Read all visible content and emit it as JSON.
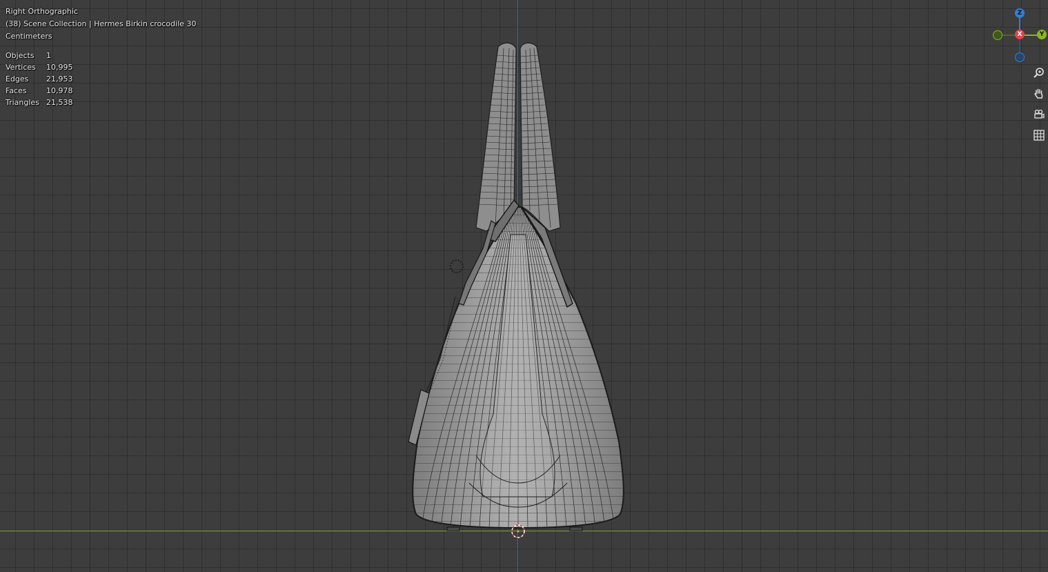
{
  "viewport": {
    "view_name": "Right Orthographic",
    "collection_line": "(38) Scene Collection | Hermes Birkin crocodile 30",
    "units": "Centimeters"
  },
  "stats": [
    {
      "label": "Objects",
      "value": "1"
    },
    {
      "label": "Vertices",
      "value": "10,995"
    },
    {
      "label": "Edges",
      "value": "21,953"
    },
    {
      "label": "Faces",
      "value": "10,978"
    },
    {
      "label": "Triangles",
      "value": "21,538"
    }
  ],
  "gizmo": {
    "z_label": "Z",
    "x_label": "X",
    "y_label": "Y",
    "colors": {
      "z": "#2f7fd6",
      "x": "#e8404f",
      "y": "#84b820",
      "neg_y": "#4e6b1f",
      "neg_z": "#28527f"
    }
  },
  "tools": [
    "zoom-icon",
    "pan-hand-icon",
    "camera-icon",
    "grid-icon"
  ],
  "colors": {
    "background": "#3d3d3d",
    "z_axis_line": "#3a6ed8",
    "y_axis_line": "#8bb84a",
    "mesh_fill": "#9a9a9a",
    "wire": "#1e1e1e"
  }
}
